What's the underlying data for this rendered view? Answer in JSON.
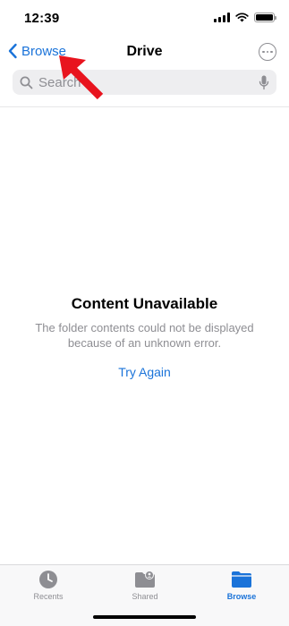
{
  "status_bar": {
    "time": "12:39"
  },
  "nav": {
    "back_label": "Browse",
    "title": "Drive"
  },
  "search": {
    "placeholder": "Search"
  },
  "empty_state": {
    "title": "Content Unavailable",
    "message": "The folder contents could not be displayed because of an unknown error.",
    "action_label": "Try Again"
  },
  "tabs": [
    {
      "label": "Recents",
      "icon": "clock-icon",
      "active": false
    },
    {
      "label": "Shared",
      "icon": "shared-folder-icon",
      "active": false
    },
    {
      "label": "Browse",
      "icon": "folder-icon",
      "active": true
    }
  ],
  "colors": {
    "accent": "#1a73d9",
    "annotation_arrow": "#e8141e",
    "secondary_text": "#8e8e93"
  },
  "annotation": {
    "type": "arrow",
    "points_to": "back-button"
  }
}
